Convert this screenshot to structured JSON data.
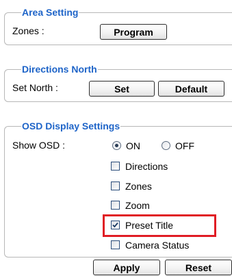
{
  "area_setting": {
    "legend": "Area Setting",
    "zones_label": "Zones :",
    "program_button": "Program"
  },
  "directions_north": {
    "legend": "Directions North",
    "set_north_label": "Set North :",
    "set_button": "Set",
    "default_button": "Default"
  },
  "osd_display": {
    "legend": "OSD Display Settings",
    "show_osd_label": "Show OSD :",
    "radio_on": {
      "label": "ON",
      "selected": true
    },
    "radio_off": {
      "label": "OFF",
      "selected": false
    },
    "options": [
      {
        "label": "Directions",
        "checked": false
      },
      {
        "label": "Zones",
        "checked": false
      },
      {
        "label": "Zoom",
        "checked": false
      },
      {
        "label": "Preset Title",
        "checked": true,
        "highlighted": true
      },
      {
        "label": "Camera Status",
        "checked": false
      }
    ],
    "highlight_color": "#e01c24"
  },
  "footer": {
    "apply_button": "Apply",
    "reset_button": "Reset"
  },
  "colors": {
    "legend": "#1e64c8",
    "border": "#b7b7b7"
  }
}
